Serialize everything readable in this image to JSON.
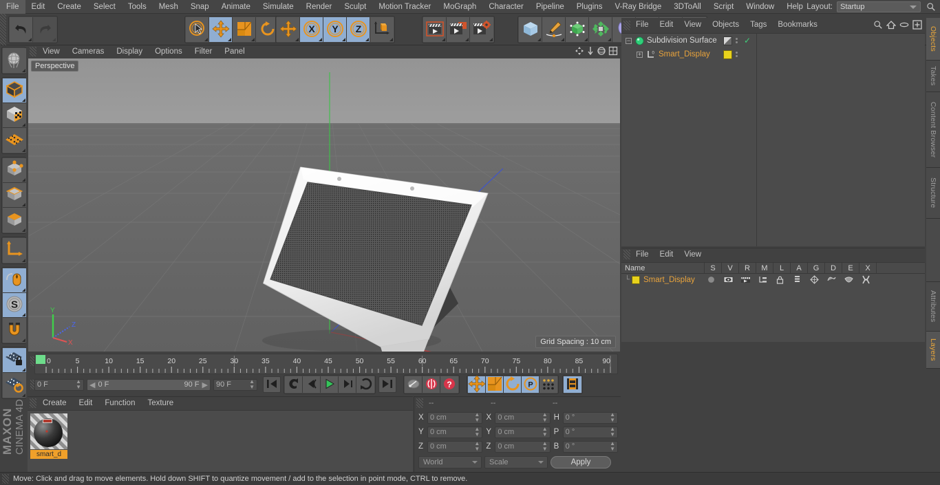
{
  "menubar": {
    "items": [
      "File",
      "Edit",
      "Create",
      "Select",
      "Tools",
      "Mesh",
      "Snap",
      "Animate",
      "Simulate",
      "Render",
      "Sculpt",
      "Motion Tracker",
      "MoGraph",
      "Character",
      "Pipeline",
      "Plugins",
      "V-Ray Bridge",
      "3DToAll",
      "Script",
      "Window",
      "Help"
    ],
    "layout_label": "Layout:",
    "layout_value": "Startup",
    "search_icon": "search-icon"
  },
  "toolbar": {
    "groups": [
      {
        "name": "undo-redo",
        "buttons": [
          {
            "name": "undo-button",
            "icon": "undo-arrow-icon",
            "selected": false,
            "disabled": false
          },
          {
            "name": "redo-button",
            "icon": "redo-arrow-icon",
            "selected": false,
            "disabled": true
          }
        ]
      },
      {
        "name": "transform-tools",
        "buttons": [
          {
            "name": "live-selection-tool",
            "icon": "cursor-circle-icon",
            "selected": false,
            "disabled": false
          },
          {
            "name": "move-tool",
            "icon": "move-arrows-icon",
            "selected": true,
            "disabled": false
          },
          {
            "name": "scale-tool",
            "icon": "scale-box-icon",
            "selected": false,
            "disabled": false
          },
          {
            "name": "rotate-tool",
            "icon": "rotate-arc-icon",
            "selected": false,
            "disabled": false
          }
        ]
      },
      {
        "name": "axis-lock",
        "buttons": [
          {
            "name": "world-axis-toggle",
            "icon": "move-arrows-icon",
            "selected": false,
            "disabled": false
          },
          {
            "name": "lock-x-axis",
            "icon": "x-axis-icon",
            "selected": true,
            "disabled": false
          },
          {
            "name": "lock-y-axis",
            "icon": "y-axis-icon",
            "selected": true,
            "disabled": false
          },
          {
            "name": "lock-z-axis",
            "icon": "z-axis-icon",
            "selected": true,
            "disabled": false
          },
          {
            "name": "world-object-coordinates",
            "icon": "cube-axis-icon",
            "selected": false,
            "disabled": false
          }
        ]
      },
      {
        "name": "render-tools",
        "buttons": [
          {
            "name": "render-view-button",
            "icon": "clapboard-icon",
            "selected": false,
            "disabled": false
          },
          {
            "name": "render-to-picture-viewer-button",
            "icon": "clapboard-frame-icon",
            "selected": false,
            "disabled": false
          },
          {
            "name": "render-settings-button",
            "icon": "clapboard-gear-icon",
            "selected": false,
            "disabled": false
          }
        ]
      },
      {
        "name": "create-objects",
        "buttons": [
          {
            "name": "add-cube-button",
            "icon": "cube-icon",
            "selected": false,
            "disabled": false
          },
          {
            "name": "add-spline-button",
            "icon": "pen-spline-icon",
            "selected": false,
            "disabled": false
          },
          {
            "name": "add-generator-button",
            "icon": "nurbs-cube-icon",
            "selected": false,
            "disabled": false
          },
          {
            "name": "add-deformer-button",
            "icon": "deformer-icon",
            "selected": false,
            "disabled": false
          },
          {
            "name": "add-bend-button",
            "icon": "bend-icon",
            "selected": false,
            "disabled": false
          },
          {
            "name": "add-floor-button",
            "icon": "floor-grid-icon",
            "selected": false,
            "disabled": false
          },
          {
            "name": "add-camera-button",
            "icon": "camera-icon",
            "selected": false,
            "disabled": false
          },
          {
            "name": "add-light-button",
            "icon": "light-bulb-icon",
            "selected": false,
            "disabled": false
          }
        ]
      }
    ]
  },
  "left_toolbar": {
    "groups": [
      {
        "name": "undo-view-group",
        "buttons": [
          {
            "name": "make-editable-button",
            "icon": "globe-wire-icon",
            "selected": false
          }
        ]
      },
      {
        "name": "mode-group",
        "buttons": [
          {
            "name": "model-mode-button",
            "icon": "model-cube-icon",
            "selected": true
          },
          {
            "name": "texture-mode-button",
            "icon": "texture-cube-icon",
            "selected": false
          },
          {
            "name": "workplane-mode-button",
            "icon": "workplane-icon",
            "selected": false
          }
        ]
      },
      {
        "name": "component-group",
        "buttons": [
          {
            "name": "points-mode-button",
            "icon": "points-cube-icon",
            "selected": false
          },
          {
            "name": "edges-mode-button",
            "icon": "edges-cube-icon",
            "selected": false
          },
          {
            "name": "polygons-mode-button",
            "icon": "polygons-cube-icon",
            "selected": false
          }
        ]
      },
      {
        "name": "axis-group",
        "buttons": [
          {
            "name": "enable-axis-button",
            "icon": "axis-l-icon",
            "selected": false
          }
        ]
      },
      {
        "name": "snap-group",
        "buttons": [
          {
            "name": "viewport-solo-button",
            "icon": "mouse-icon",
            "selected": true
          },
          {
            "name": "enable-snap-button",
            "icon": "snap-s-icon",
            "selected": true
          },
          {
            "name": "magnet-tool-button",
            "icon": "magnet-icon",
            "selected": false
          }
        ]
      },
      {
        "name": "workplane-group",
        "buttons": [
          {
            "name": "lock-workplane-button",
            "icon": "workplane-lock-icon",
            "selected": true
          },
          {
            "name": "planar-workplane-button",
            "icon": "workplane-rotate-icon",
            "selected": false
          }
        ]
      }
    ],
    "brand_line1": "MAXON",
    "brand_line2": "CINEMA 4D"
  },
  "viewport": {
    "menu": [
      "View",
      "Cameras",
      "Display",
      "Options",
      "Filter",
      "Panel"
    ],
    "view_label": "Perspective",
    "grid_spacing": "Grid Spacing : 10 cm",
    "axis_labels": {
      "x": "X",
      "y": "Y",
      "z": "Z"
    },
    "icons": [
      "pan-icon",
      "zoom-icon",
      "rotate-view-icon",
      "maximize-view-icon"
    ]
  },
  "timeline": {
    "ticks": [
      {
        "label": "0",
        "frame": 0
      },
      {
        "label": "5",
        "frame": 5
      },
      {
        "label": "10",
        "frame": 10
      },
      {
        "label": "15",
        "frame": 15
      },
      {
        "label": "20",
        "frame": 20
      },
      {
        "label": "25",
        "frame": 25
      },
      {
        "label": "30",
        "frame": 30
      },
      {
        "label": "35",
        "frame": 35
      },
      {
        "label": "40",
        "frame": 40
      },
      {
        "label": "45",
        "frame": 45
      },
      {
        "label": "50",
        "frame": 50
      },
      {
        "label": "55",
        "frame": 55
      },
      {
        "label": "60",
        "frame": 60
      },
      {
        "label": "65",
        "frame": 65
      },
      {
        "label": "70",
        "frame": 70
      },
      {
        "label": "75",
        "frame": 75
      },
      {
        "label": "80",
        "frame": 80
      },
      {
        "label": "85",
        "frame": 85
      },
      {
        "label": "90",
        "frame": 90
      }
    ],
    "current_frame_field": "0 F",
    "end_field_right": "0 F",
    "range_start": "0 F",
    "range_end": "90 F",
    "max_frame_field": "90 F",
    "playback_buttons": [
      {
        "name": "go-to-start-button",
        "icon": "skip-start-icon"
      },
      {
        "name": "go-to-previous-key-button",
        "icon": "prev-key-icon"
      },
      {
        "name": "go-to-previous-frame-button",
        "icon": "prev-frame-icon"
      },
      {
        "name": "play-button",
        "icon": "play-icon"
      },
      {
        "name": "go-to-next-frame-button",
        "icon": "next-frame-icon"
      },
      {
        "name": "go-to-next-key-button",
        "icon": "next-key-icon"
      },
      {
        "name": "go-to-end-button",
        "icon": "skip-end-icon"
      }
    ],
    "record_buttons": [
      {
        "name": "record-active-objects-button",
        "icon": "key-icon"
      },
      {
        "name": "autokeying-button",
        "icon": "autokey-icon"
      },
      {
        "name": "keyframe-selection-button",
        "icon": "question-key-icon"
      }
    ],
    "key_toggle_buttons": [
      {
        "name": "position-key-toggle",
        "icon": "move-arrows-icon",
        "selected": true
      },
      {
        "name": "scale-key-toggle",
        "icon": "scale-box-icon",
        "selected": true
      },
      {
        "name": "rotation-key-toggle",
        "icon": "rotate-arc-icon",
        "selected": true
      },
      {
        "name": "parameter-key-toggle",
        "icon": "p-circle-icon",
        "selected": true
      },
      {
        "name": "point-level-animation-toggle",
        "icon": "dots-grid-icon",
        "selected": false
      },
      {
        "name": "timeline-toggle",
        "icon": "film-strip-icon",
        "selected": true
      }
    ]
  },
  "material_manager": {
    "menu": [
      "Create",
      "Edit",
      "Function",
      "Texture"
    ],
    "materials": [
      {
        "name": "smart_d",
        "selected": true
      }
    ]
  },
  "coordinates": {
    "header_dashes": [
      "--",
      "--",
      "--"
    ],
    "rows": [
      {
        "pos_label": "X",
        "pos_value": "0 cm",
        "size_label": "X",
        "size_value": "0 cm",
        "rot_label": "H",
        "rot_value": "0 °"
      },
      {
        "pos_label": "Y",
        "pos_value": "0 cm",
        "size_label": "Y",
        "size_value": "0 cm",
        "rot_label": "P",
        "rot_value": "0 °"
      },
      {
        "pos_label": "Z",
        "pos_value": "0 cm",
        "size_label": "Z",
        "size_value": "0 cm",
        "rot_label": "B",
        "rot_value": "0 °"
      }
    ],
    "coord_system": "World",
    "size_mode": "Scale",
    "apply_label": "Apply"
  },
  "object_manager": {
    "menu": [
      "File",
      "Edit",
      "View",
      "Objects",
      "Tags",
      "Bookmarks"
    ],
    "icons": [
      "search-icon",
      "home-icon",
      "ellipse-icon",
      "plus-box-icon"
    ],
    "objects": [
      {
        "name": "Subdivision Surface",
        "icon": "subdivision-surface-icon",
        "color": "#2fd07a",
        "indent": 0,
        "expander": "minus",
        "has_tag_swatch": true,
        "tag_swatch": "gradient",
        "checked": true,
        "name_color": "#d6d6d6"
      },
      {
        "name": "Smart_Display",
        "icon": "null-object-icon",
        "color": "#d8d8d8",
        "indent": 1,
        "expander": "plus",
        "has_tag_swatch": true,
        "tag_swatch": "#e8d21c",
        "checked": false,
        "name_color": "#e8a33c"
      }
    ]
  },
  "layer_manager": {
    "menu": [
      "File",
      "Edit",
      "View"
    ],
    "columns": [
      "Name",
      "S",
      "V",
      "R",
      "M",
      "L",
      "A",
      "G",
      "D",
      "E",
      "X"
    ],
    "rows": [
      {
        "name": "Smart_Display",
        "swatch": "#e8d21c",
        "name_color": "#e8a33c",
        "cells": [
          "solo-dot",
          "visible-eye",
          "render-clapboard",
          "manager-icon",
          "lock-icon",
          "animation-icon",
          "generator-icon",
          "deformer-icon",
          "expression-icon",
          "xref-icon"
        ]
      }
    ]
  },
  "vertical_tabs": [
    {
      "label": "Objects",
      "active": true
    },
    {
      "label": "Takes",
      "active": false
    },
    {
      "label": "Content Browser",
      "active": false
    },
    {
      "label": "Structure",
      "active": false
    },
    {
      "label": "",
      "active": false
    },
    {
      "label": "Attributes",
      "active": false
    },
    {
      "label": "Layers",
      "active": true
    }
  ],
  "statusbar": {
    "message": "Move: Click and drag to move elements. Hold down SHIFT to quantize movement / add to the selection in point mode, CTRL to remove."
  },
  "colors": {
    "accent_orange": "#e8a33c",
    "selected_blue": "#90aed2",
    "panel_bg": "#414141",
    "list_bg": "#4b4b4b",
    "green": "#2fd07a"
  }
}
